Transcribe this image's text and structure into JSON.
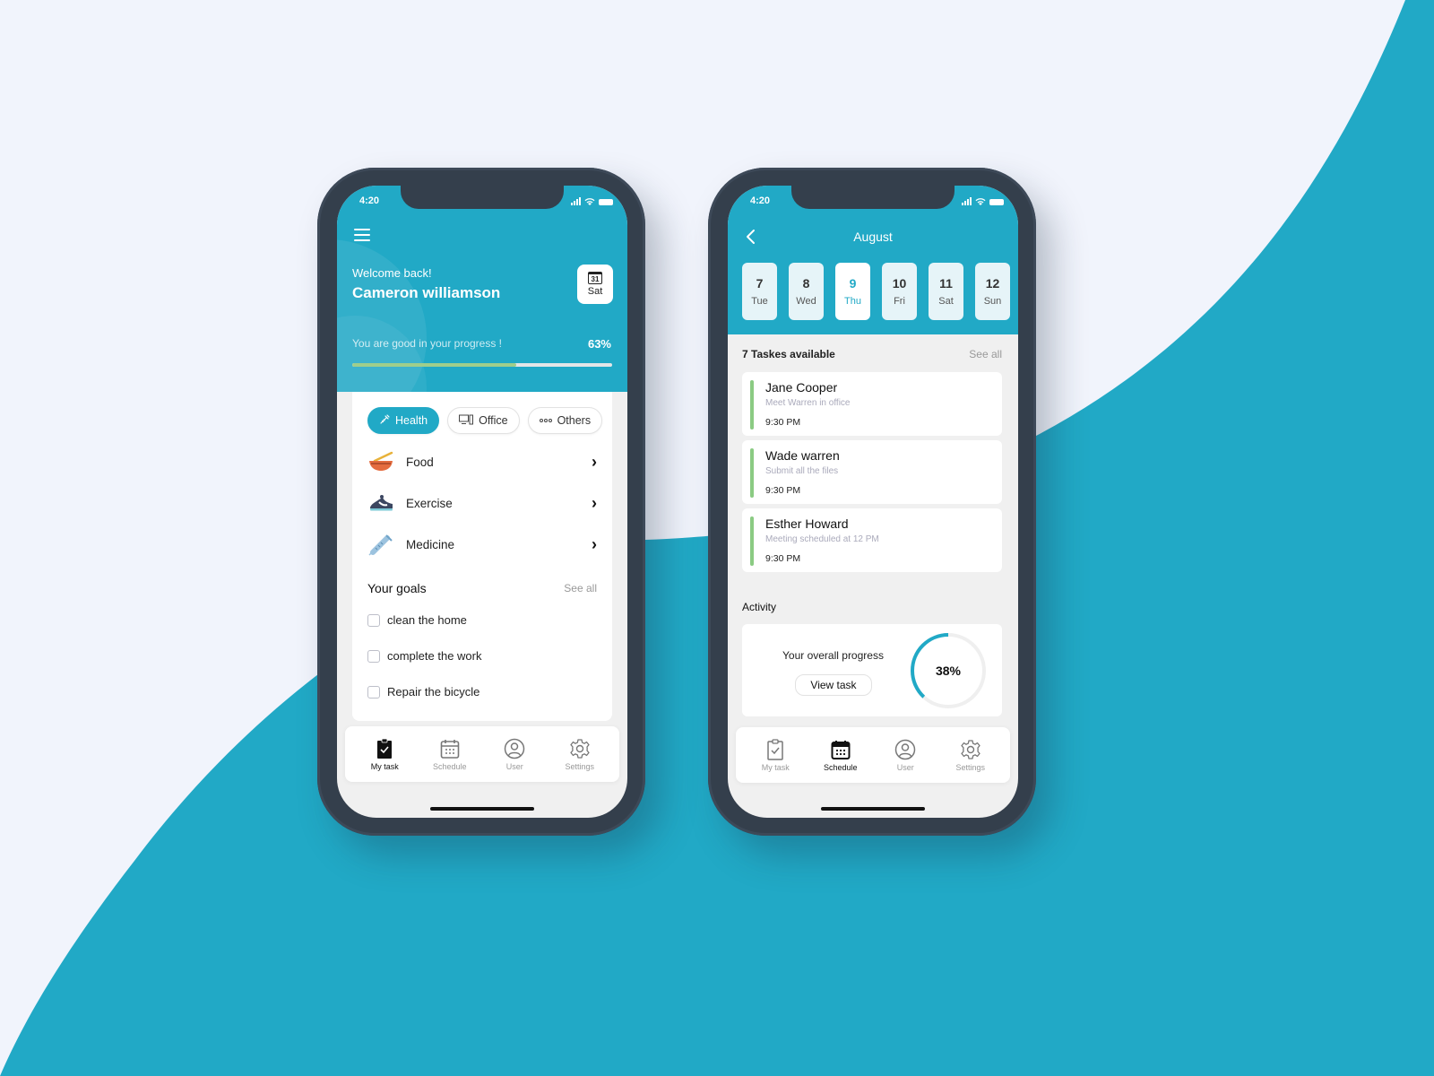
{
  "colors": {
    "brand": "#21A9C6",
    "background": "#F1F4FC",
    "progress_fill": "#9FCE8C",
    "task_accent": "#8BCB83",
    "frame": "#343F4C"
  },
  "status_bar": {
    "time": "4:20"
  },
  "home_screen": {
    "menu_icon": "hamburger-menu-icon",
    "welcome": "Welcome back!",
    "username": "Cameron williamson",
    "date_chip": {
      "day_number": "31",
      "day_name": "Sat"
    },
    "progress": {
      "label": "You are good in your progress !",
      "value_text": "63%",
      "value_percent": 63
    },
    "chips": [
      {
        "label": "Health",
        "icon": "syringe-icon",
        "active": true
      },
      {
        "label": "Office",
        "icon": "computer-icon",
        "active": false
      },
      {
        "label": "Others",
        "icon": "dots-icon",
        "active": false
      }
    ],
    "categories": [
      {
        "label": "Food",
        "icon": "food-bowl-icon"
      },
      {
        "label": "Exercise",
        "icon": "sneaker-icon"
      },
      {
        "label": "Medicine",
        "icon": "syringe-icon"
      }
    ],
    "goals": {
      "title": "Your goals",
      "see_all": "See all",
      "items": [
        {
          "label": "clean the home",
          "checked": false
        },
        {
          "label": "complete the work",
          "checked": false
        },
        {
          "label": "Repair the bicycle",
          "checked": false
        }
      ]
    },
    "tabbar": [
      {
        "label": "My task",
        "icon": "clipboard-check-icon",
        "active": true
      },
      {
        "label": "Schedule",
        "icon": "calendar-icon",
        "active": false
      },
      {
        "label": "User",
        "icon": "user-icon",
        "active": false
      },
      {
        "label": "Settings",
        "icon": "gear-icon",
        "active": false
      }
    ]
  },
  "schedule_screen": {
    "month": "August",
    "days": [
      {
        "num": "7",
        "name": "Tue",
        "selected": false
      },
      {
        "num": "8",
        "name": "Wed",
        "selected": false
      },
      {
        "num": "9",
        "name": "Thu",
        "selected": true
      },
      {
        "num": "10",
        "name": "Fri",
        "selected": false
      },
      {
        "num": "11",
        "name": "Sat",
        "selected": false
      },
      {
        "num": "12",
        "name": "Sun",
        "selected": false
      }
    ],
    "tasks_title": "7 Taskes available",
    "see_all": "See all",
    "tasks": [
      {
        "name": "Jane Cooper",
        "desc": "Meet Warren in office",
        "time": "9:30 PM"
      },
      {
        "name": "Wade warren",
        "desc": "Submit all the files",
        "time": "9:30 PM"
      },
      {
        "name": "Esther Howard",
        "desc": "Meeting scheduled at 12 PM",
        "time": "9:30 PM"
      }
    ],
    "activity": {
      "title": "Activity",
      "label": "Your overall progress",
      "button": "View task",
      "value_text": "38%",
      "value_percent": 38
    },
    "tabbar": [
      {
        "label": "My task",
        "icon": "clipboard-check-icon",
        "active": false
      },
      {
        "label": "Schedule",
        "icon": "calendar-icon",
        "active": true
      },
      {
        "label": "User",
        "icon": "user-icon",
        "active": false
      },
      {
        "label": "Settings",
        "icon": "gear-icon",
        "active": false
      }
    ]
  }
}
